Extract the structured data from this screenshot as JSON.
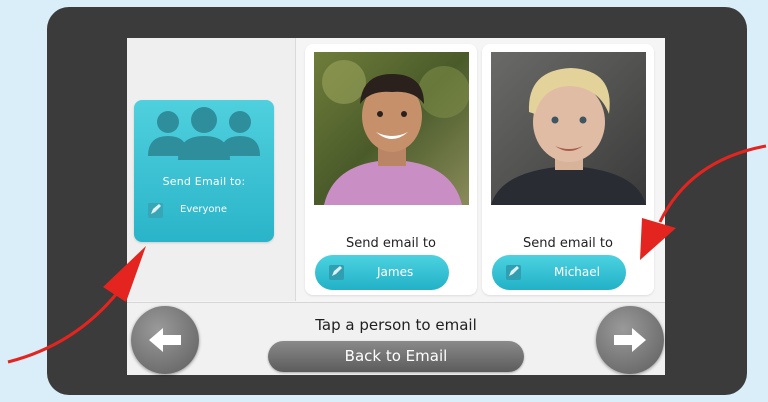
{
  "colors": {
    "page_background": "#d9eef9",
    "device_frame": "#3b3b3b",
    "accent_teal": "#2ab4c9",
    "nav_gray": "#6e6e6e",
    "annotation_red": "#e3241f"
  },
  "everyone_card": {
    "icon": "group-icon",
    "title": "Send Email to:",
    "checkbox_icon": "edit-checkbox-icon",
    "label": "Everyone"
  },
  "contacts": [
    {
      "photo": "james-photo",
      "send_label": "Send email to",
      "name": "James",
      "checkbox_icon": "edit-checkbox-icon"
    },
    {
      "photo": "michael-photo",
      "send_label": "Send email to",
      "name": "Michael",
      "checkbox_icon": "edit-checkbox-icon"
    }
  ],
  "footer": {
    "hint": "Tap a person to email",
    "back_label": "Back to Email",
    "prev_icon": "arrow-left-icon",
    "next_icon": "arrow-right-icon"
  }
}
